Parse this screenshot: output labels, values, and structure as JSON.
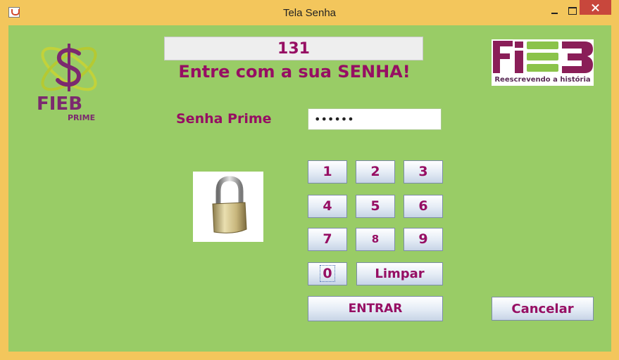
{
  "window": {
    "title": "Tela Senha"
  },
  "counter": {
    "value": "131"
  },
  "heading": "Entre com a sua SENHA!",
  "password": {
    "label": "Senha Prime",
    "value": "••••••"
  },
  "keypad": {
    "k1": "1",
    "k2": "2",
    "k3": "3",
    "k4": "4",
    "k5": "5",
    "k6": "6",
    "k7": "7",
    "k8": "8",
    "k9": "9",
    "k0": "0",
    "clear": "Limpar"
  },
  "buttons": {
    "enter": "ENTRAR",
    "cancel": "Cancelar"
  },
  "logos": {
    "left": {
      "letters": "FIEB",
      "sub": "PRIME"
    },
    "right": {
      "letters": "FIEB",
      "tagline": "Reescrevendo a história"
    }
  },
  "colors": {
    "background": "#99cc66",
    "accent": "#960e63",
    "titlebar": "#f3c65c"
  }
}
